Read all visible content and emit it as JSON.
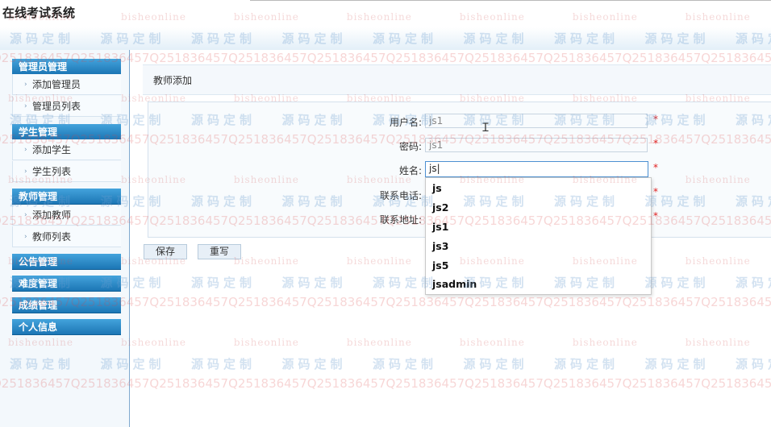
{
  "app": {
    "title": "在线考试系统"
  },
  "menu": [
    {
      "label": "管理员管理",
      "items": [
        "添加管理员",
        "管理员列表"
      ]
    },
    {
      "label": "学生管理",
      "items": [
        "添加学生",
        "学生列表"
      ]
    },
    {
      "label": "教师管理",
      "items": [
        "添加教师",
        "教师列表"
      ]
    },
    {
      "label": "公告管理",
      "items": []
    },
    {
      "label": "难度管理",
      "items": []
    },
    {
      "label": "成绩管理",
      "items": []
    },
    {
      "label": "个人信息",
      "items": []
    }
  ],
  "form": {
    "title": "教师添加",
    "fields": [
      {
        "label": "用户名:",
        "value": "js1",
        "required_mark": "*"
      },
      {
        "label": "密码:",
        "value": "js1",
        "required_mark": "*"
      },
      {
        "label": "姓名:",
        "value": "js",
        "required_mark": "*"
      },
      {
        "label": "联系电话:",
        "value": "",
        "required_mark": "*"
      },
      {
        "label": "联系地址:",
        "value": "",
        "required_mark": "*"
      }
    ],
    "buttons": {
      "save": "保存",
      "reset": "重写"
    }
  },
  "autocomplete": {
    "options": [
      "js",
      "js2",
      "js1",
      "js3",
      "js5",
      "jsadmin"
    ]
  },
  "watermark": {
    "online": "bisheonline",
    "cn": "源码定制",
    "qq": "Q2518364 57"
  },
  "colors": {
    "menu_header": "#1c76b5",
    "required": "#e02020",
    "focus_border": "#4d90d2"
  }
}
